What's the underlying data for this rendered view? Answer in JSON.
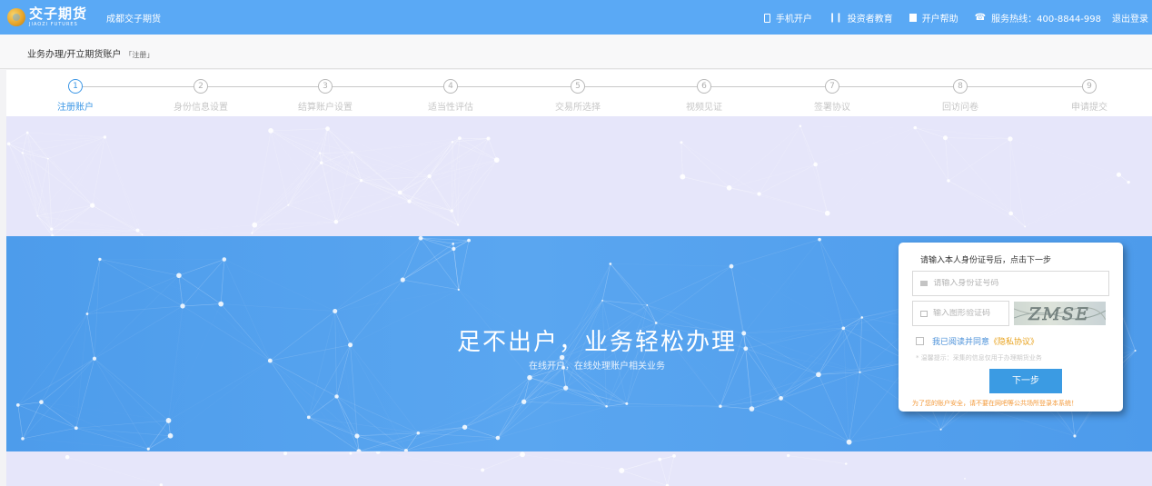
{
  "header": {
    "logo_cn": "交子期货",
    "logo_en": "JIAOZI FUTURES",
    "company": "成都交子期货",
    "nav": {
      "mobile": "手机开户",
      "investor_edu": "投资者教育",
      "help": "开户帮助",
      "hotline": "服务热线：400-8844-998",
      "logout": "退出登录"
    }
  },
  "breadcrumb": {
    "path": "业务办理/开立期货账户",
    "tag": "「注册」"
  },
  "steps": [
    {
      "num": "1",
      "label": "注册账户",
      "active": true
    },
    {
      "num": "2",
      "label": "身份信息设置",
      "active": false
    },
    {
      "num": "3",
      "label": "结算账户设置",
      "active": false
    },
    {
      "num": "4",
      "label": "适当性评估",
      "active": false
    },
    {
      "num": "5",
      "label": "交易所选择",
      "active": false
    },
    {
      "num": "6",
      "label": "视频见证",
      "active": false
    },
    {
      "num": "7",
      "label": "签署协议",
      "active": false
    },
    {
      "num": "8",
      "label": "回访问卷",
      "active": false
    },
    {
      "num": "9",
      "label": "申请提交",
      "active": false
    }
  ],
  "hero": {
    "title": "足不出户，业务轻松办理",
    "subtitle": "在线开户，在线处理账户相关业务"
  },
  "form": {
    "title": "请输入本人身份证号后，点击下一步",
    "id_placeholder": "请输入身份证号码",
    "captcha_placeholder": "输入图形验证码",
    "captcha_text": "ZMSE",
    "agree_text": "我已阅读并同意",
    "agree_link": "《隐私协议》",
    "tip": "* 温馨提示：采集的信息仅用于办理期货业务",
    "next_label": "下一步",
    "warning": "为了您的账户安全，请不要在网吧等公共场所登录本系统！"
  },
  "colors": {
    "topbar": "#5aa9f5",
    "accent": "#3b9be3",
    "active_step": "#3c97e6",
    "warning": "#f39a3b",
    "link": "#e8a11b"
  }
}
